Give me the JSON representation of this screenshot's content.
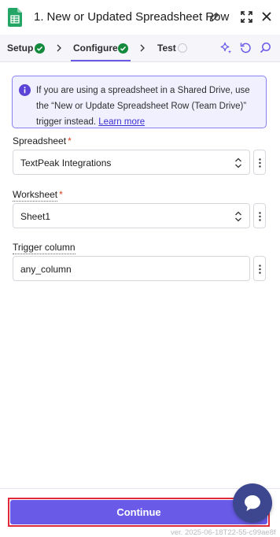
{
  "header": {
    "step_number": "1.",
    "title": "New or Updated Spreadsheet Row"
  },
  "tabs": [
    {
      "label": "Setup",
      "status": "complete"
    },
    {
      "label": "Configure",
      "status": "complete",
      "active": true
    },
    {
      "label": "Test",
      "status": "pending"
    }
  ],
  "info": {
    "text": "If you are using a spreadsheet in a Shared Drive, use the “New or Update Spreadsheet Row (Team Drive)” trigger instead.",
    "link": "Learn more"
  },
  "fields": {
    "spreadsheet": {
      "label": "Spreadsheet",
      "required_mark": "*",
      "value": "TextPeak Integrations"
    },
    "worksheet": {
      "label": "Worksheet",
      "required_mark": "*",
      "value": "Sheet1"
    },
    "trigger_column": {
      "label": "Trigger column",
      "value": "any_column"
    }
  },
  "footer": {
    "continue_label": "Continue",
    "version": "ver. 2025-06-18T22-55-c99ae8f"
  },
  "colors": {
    "accent": "#695be8",
    "success": "#138a3c",
    "required": "#d9401d",
    "highlight": "#e02a3a",
    "chat": "#3d4790"
  },
  "icons": [
    "google-sheets-icon",
    "pencil-icon",
    "expand-icon",
    "close-icon",
    "check-circle-icon",
    "chevron-right-icon",
    "pending-circle-icon",
    "sparkle-icon",
    "undo-icon",
    "search-icon",
    "info-icon",
    "up-down-icon",
    "more-vertical-icon",
    "chat-icon"
  ]
}
